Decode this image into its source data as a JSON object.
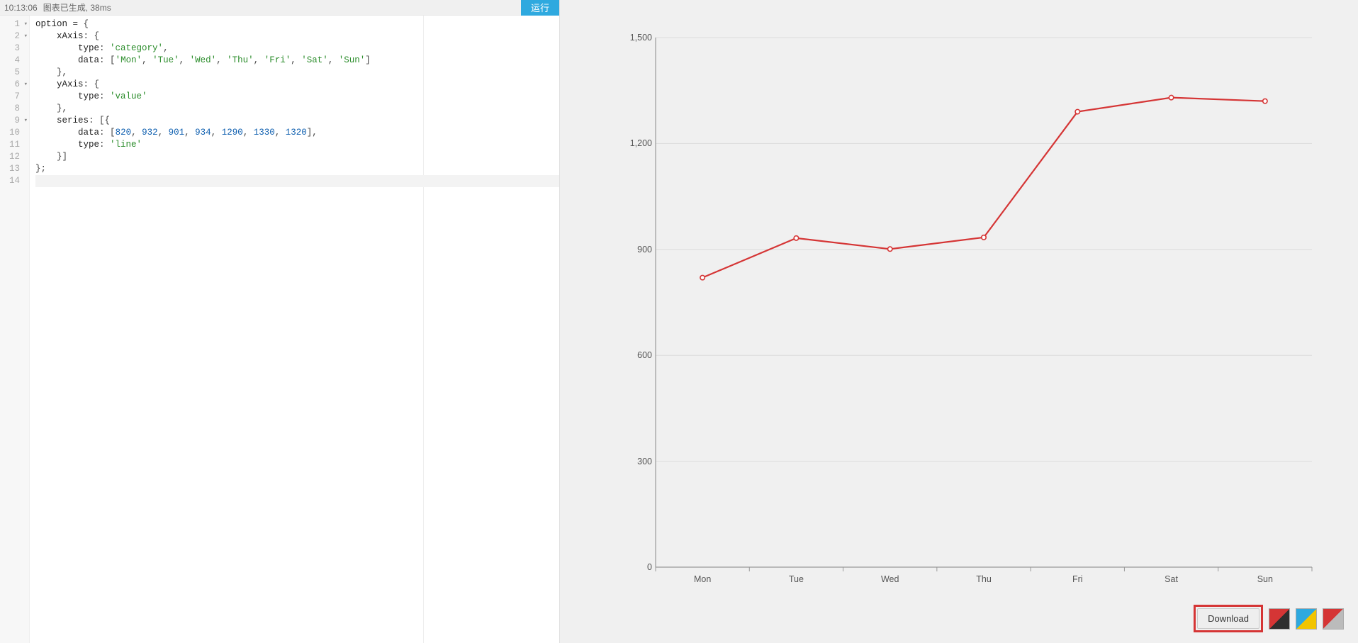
{
  "status": {
    "time": "10:13:06",
    "message": "图表已生成, 38ms"
  },
  "run_label": "运行",
  "editor": {
    "line_count": 14,
    "fold_lines": [
      1,
      2,
      6,
      9
    ],
    "active_line": 14,
    "rows": [
      [
        [
          "plain",
          "option "
        ],
        [
          "punc",
          "="
        ],
        [
          "plain",
          " "
        ],
        [
          "punc",
          "{"
        ]
      ],
      [
        [
          "plain",
          "    xAxis"
        ],
        [
          "punc",
          ":"
        ],
        [
          "plain",
          " "
        ],
        [
          "punc",
          "{"
        ]
      ],
      [
        [
          "plain",
          "        type"
        ],
        [
          "punc",
          ":"
        ],
        [
          "plain",
          " "
        ],
        [
          "str",
          "'category'"
        ],
        [
          "punc",
          ","
        ]
      ],
      [
        [
          "plain",
          "        data"
        ],
        [
          "punc",
          ":"
        ],
        [
          "plain",
          " "
        ],
        [
          "punc",
          "["
        ],
        [
          "str",
          "'Mon'"
        ],
        [
          "punc",
          ", "
        ],
        [
          "str",
          "'Tue'"
        ],
        [
          "punc",
          ", "
        ],
        [
          "str",
          "'Wed'"
        ],
        [
          "punc",
          ", "
        ],
        [
          "str",
          "'Thu'"
        ],
        [
          "punc",
          ", "
        ],
        [
          "str",
          "'Fri'"
        ],
        [
          "punc",
          ", "
        ],
        [
          "str",
          "'Sat'"
        ],
        [
          "punc",
          ", "
        ],
        [
          "str",
          "'Sun'"
        ],
        [
          "punc",
          "]"
        ]
      ],
      [
        [
          "plain",
          "    "
        ],
        [
          "punc",
          "},"
        ]
      ],
      [
        [
          "plain",
          "    yAxis"
        ],
        [
          "punc",
          ":"
        ],
        [
          "plain",
          " "
        ],
        [
          "punc",
          "{"
        ]
      ],
      [
        [
          "plain",
          "        type"
        ],
        [
          "punc",
          ":"
        ],
        [
          "plain",
          " "
        ],
        [
          "str",
          "'value'"
        ]
      ],
      [
        [
          "plain",
          "    "
        ],
        [
          "punc",
          "},"
        ]
      ],
      [
        [
          "plain",
          "    series"
        ],
        [
          "punc",
          ":"
        ],
        [
          "plain",
          " "
        ],
        [
          "punc",
          "[{"
        ]
      ],
      [
        [
          "plain",
          "        data"
        ],
        [
          "punc",
          ":"
        ],
        [
          "plain",
          " "
        ],
        [
          "punc",
          "["
        ],
        [
          "num",
          "820"
        ],
        [
          "punc",
          ", "
        ],
        [
          "num",
          "932"
        ],
        [
          "punc",
          ", "
        ],
        [
          "num",
          "901"
        ],
        [
          "punc",
          ", "
        ],
        [
          "num",
          "934"
        ],
        [
          "punc",
          ", "
        ],
        [
          "num",
          "1290"
        ],
        [
          "punc",
          ", "
        ],
        [
          "num",
          "1330"
        ],
        [
          "punc",
          ", "
        ],
        [
          "num",
          "1320"
        ],
        [
          "punc",
          "],"
        ]
      ],
      [
        [
          "plain",
          "        type"
        ],
        [
          "punc",
          ":"
        ],
        [
          "plain",
          " "
        ],
        [
          "str",
          "'line'"
        ]
      ],
      [
        [
          "plain",
          "    "
        ],
        [
          "punc",
          "}]"
        ]
      ],
      [
        [
          "punc",
          "};"
        ]
      ],
      [
        [
          "plain",
          ""
        ]
      ]
    ]
  },
  "chart_data": {
    "type": "line",
    "categories": [
      "Mon",
      "Tue",
      "Wed",
      "Thu",
      "Fri",
      "Sat",
      "Sun"
    ],
    "values": [
      820,
      932,
      901,
      934,
      1290,
      1330,
      1320
    ],
    "y_ticks": [
      0,
      300,
      600,
      900,
      1200,
      1500
    ],
    "ylim": [
      0,
      1500
    ],
    "line_color": "#d53535",
    "title": "",
    "xlabel": "",
    "ylabel": ""
  },
  "controls": {
    "download_label": "Download",
    "themes": [
      "red-dark",
      "blue-yellow",
      "red-grey"
    ]
  }
}
